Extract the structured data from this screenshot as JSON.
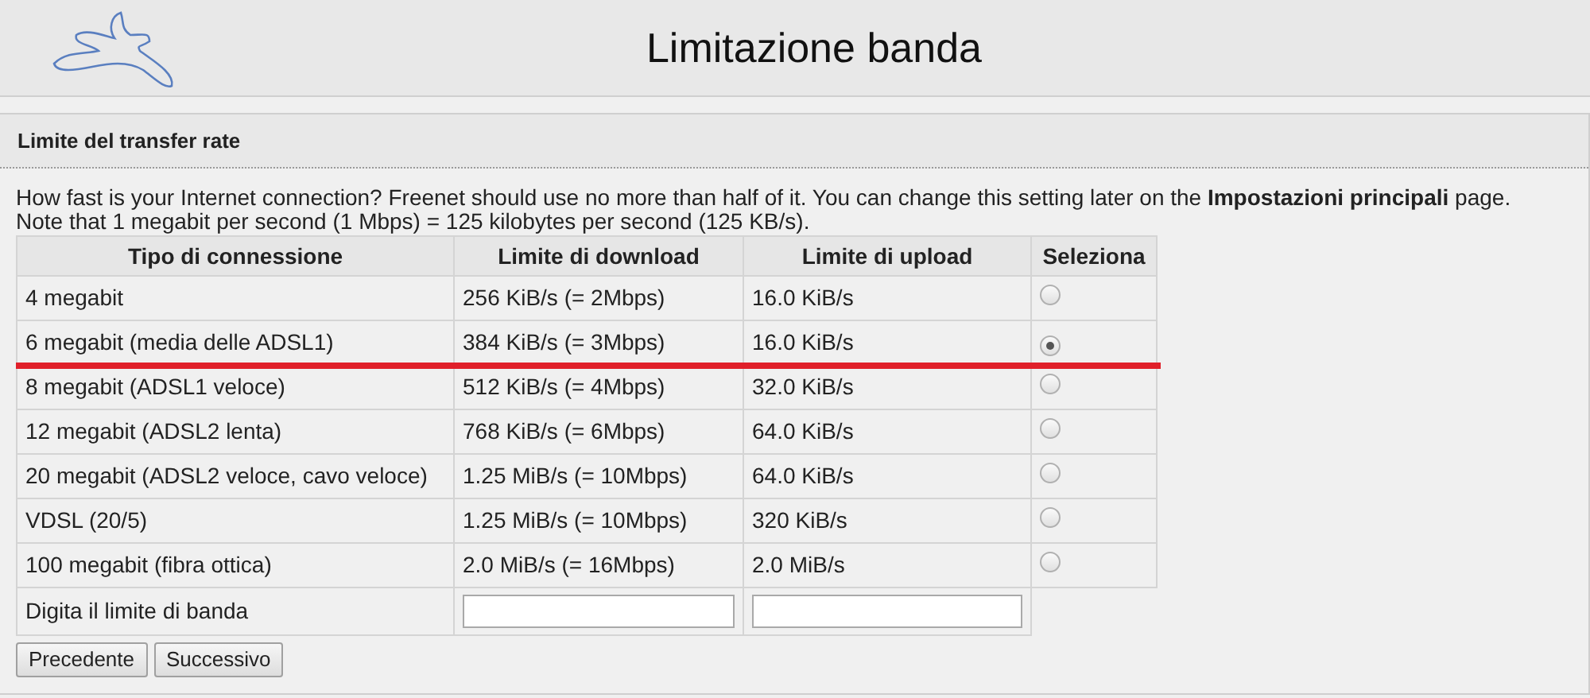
{
  "page_title": "Limitazione banda",
  "section": {
    "title": "Limite del transfer rate",
    "intro": [
      "How fast is your Internet connection? Freenet should use no more than half of it. You can change this setting later on the **Impostazioni principali** page.",
      "Note that 1 megabit per second (1 Mbps) = 125 kilobytes per second (125 KB/s)."
    ],
    "table": {
      "columns": [
        "Tipo di connessione",
        "Limite di download",
        "Limite di upload",
        "Seleziona"
      ],
      "rows": [
        {
          "type": "4 megabit",
          "download": "256 KiB/s (= 2Mbps)",
          "upload": "16.0 KiB/s",
          "selected": false
        },
        {
          "type": "6 megabit (media delle ADSL1)",
          "download": "384 KiB/s (= 3Mbps)",
          "upload": "16.0 KiB/s",
          "selected": true
        },
        {
          "type": "8 megabit (ADSL1 veloce)",
          "download": "512 KiB/s (= 4Mbps)",
          "upload": "32.0 KiB/s",
          "selected": false
        },
        {
          "type": "12 megabit (ADSL2 lenta)",
          "download": "768 KiB/s (= 6Mbps)",
          "upload": "64.0 KiB/s",
          "selected": false
        },
        {
          "type": "20 megabit (ADSL2 veloce, cavo veloce)",
          "download": "1.25 MiB/s (= 10Mbps)",
          "upload": "64.0 KiB/s",
          "selected": false
        },
        {
          "type": "VDSL (20/5)",
          "download": "1.25 MiB/s (= 10Mbps)",
          "upload": "320 KiB/s",
          "selected": false
        },
        {
          "type": "100 megabit (fibra ottica)",
          "download": "2.0 MiB/s (= 16Mbps)",
          "upload": "2.0 MiB/s",
          "selected": false
        }
      ],
      "custom_row": {
        "label": "Digita il limite di banda"
      }
    },
    "buttons": [
      "Precedente",
      "Successivo"
    ]
  }
}
